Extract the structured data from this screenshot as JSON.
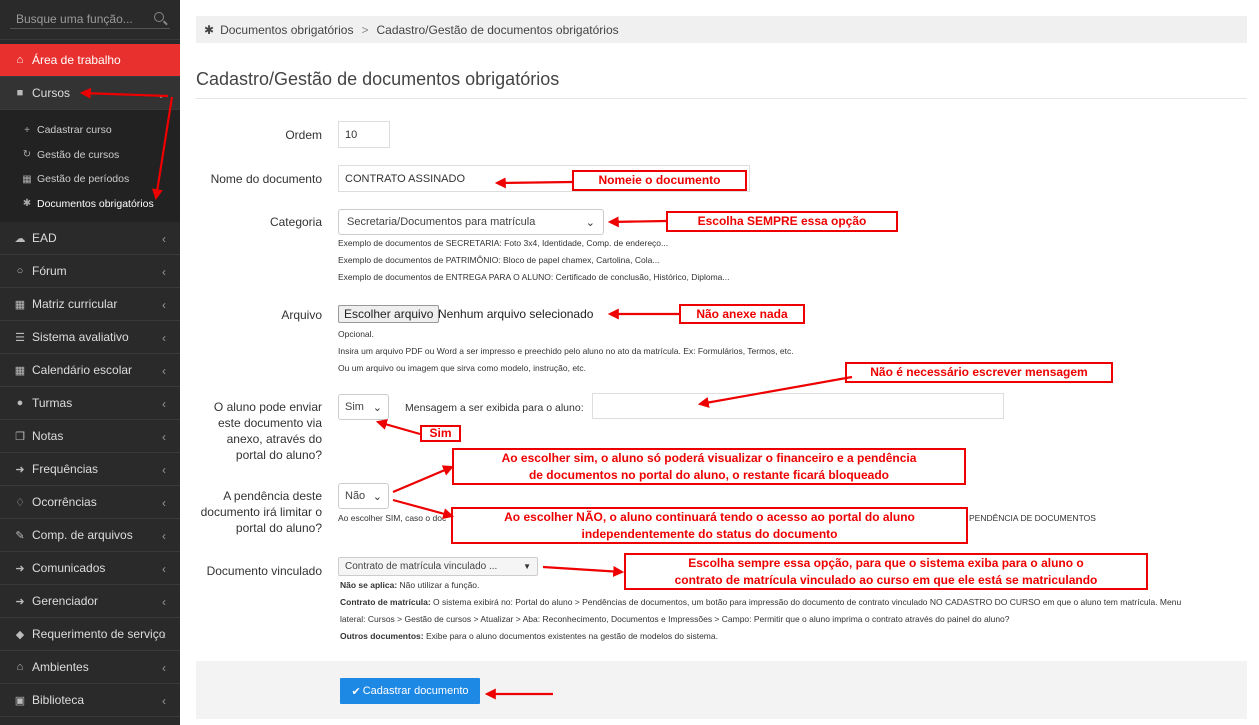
{
  "sidebar": {
    "search_placeholder": "Busque uma função...",
    "items": [
      {
        "label": "Área de trabalho",
        "icon": "home-icon"
      },
      {
        "label": "Cursos",
        "icon": "folder-icon"
      },
      {
        "label": "EAD",
        "icon": "cloud-icon"
      },
      {
        "label": "Fórum",
        "icon": "chat-icon"
      },
      {
        "label": "Matriz curricular",
        "icon": "grid-icon"
      },
      {
        "label": "Sistema avaliativo",
        "icon": "list-icon"
      },
      {
        "label": "Calendário escolar",
        "icon": "calendar-icon"
      },
      {
        "label": "Turmas",
        "icon": "users-icon"
      },
      {
        "label": "Notas",
        "icon": "copy-icon"
      },
      {
        "label": "Frequências",
        "icon": "sign-in-icon"
      },
      {
        "label": "Ocorrências",
        "icon": "bell-icon"
      },
      {
        "label": "Comp. de arquivos",
        "icon": "paperclip-icon"
      },
      {
        "label": "Comunicados",
        "icon": "sign-in-icon"
      },
      {
        "label": "Gerenciador",
        "icon": "sign-in-icon"
      },
      {
        "label": "Requerimento de serviço",
        "icon": "tag-icon"
      },
      {
        "label": "Ambientes",
        "icon": "home-icon"
      },
      {
        "label": "Biblioteca",
        "icon": "book-icon"
      }
    ],
    "subitems": [
      {
        "label": "Cadastrar curso",
        "icon": "plus-icon"
      },
      {
        "label": "Gestão de cursos",
        "icon": "refresh-icon"
      },
      {
        "label": "Gestão de períodos",
        "icon": "calendar-icon"
      },
      {
        "label": "Documentos obrigatórios",
        "icon": "asterisk-icon"
      }
    ]
  },
  "breadcrumb": {
    "item1": "Documentos obrigatórios",
    "separator": ">",
    "item2": "Cadastro/Gestão de documentos obrigatórios"
  },
  "page_title": "Cadastro/Gestão de documentos obrigatórios",
  "form": {
    "ordem_label": "Ordem",
    "ordem_value": "10",
    "nome_label": "Nome do documento",
    "nome_value": "CONTRATO ASSINADO",
    "categoria_label": "Categoria",
    "categoria_value": "Secretaria/Documentos para matrícula",
    "categoria_help": [
      "Exemplo de documentos de SECRETARIA: Foto 3x4, Identidade, Comp. de endereço...",
      "Exemplo de documentos de PATRIMÔNIO: Bloco de papel chamex, Cartolina, Cola...",
      "Exemplo de documentos de ENTREGA PARA O ALUNO: Certificado de conclusão, Histórico, Diploma..."
    ],
    "arquivo_label": "Arquivo",
    "arquivo_button": "Escolher arquivo",
    "arquivo_none": "Nenhum arquivo selecionado",
    "arquivo_help": [
      "Opcional.",
      "Insira um arquivo PDF ou Word a ser impresso e preechido pelo aluno no ato da matrícula. Ex: Formulários, Termos, etc.",
      "Ou um arquivo ou imagem que sirva como modelo, instrução, etc."
    ],
    "enviar_label": "O aluno pode enviar este documento via anexo, através do portal do aluno?",
    "enviar_value": "Sim",
    "mensagem_label": "Mensagem a ser exibida para o aluno:",
    "mensagem_value": "",
    "pendencia_label": "A pendência deste documento irá limitar o portal do aluno?",
    "pendencia_value": "Não",
    "pendencia_help_start": "Ao escolher SIM, caso o doc",
    "pendencia_help_end": "PENDÊNCIA DE DOCUMENTOS",
    "vinculado_label": "Documento vinculado",
    "vinculado_value": "Contrato de matrícula vinculado ...",
    "vinculado_help": {
      "line1_bold": "Não se aplica:",
      "line1": " Não utilizar a função.",
      "line2_bold": "Contrato de matrícula:",
      "line2": " O sistema exibirá no: Portal do aluno > Pendências de documentos, um botão para impressão do documento de contrato vinculado NO CADASTRO DO CURSO em que o aluno tem matrícula. Menu",
      "line3": "lateral: Cursos > Gestão de cursos > Atualizar > Aba: Reconhecimento, Documentos e Impressões > Campo: Permitir que o aluno imprima o contrato através do painel do aluno?",
      "line4_bold": "Outros documentos:",
      "line4": " Exibe para o aluno documentos existentes na gestão de modelos do sistema."
    },
    "submit_label": "Cadastrar documento"
  },
  "annotations": {
    "nomeie": "Nomeie o documento",
    "categoria": "Escolha SEMPRE essa opção",
    "arquivo": "Não anexe nada",
    "mensagem": "Não é necessário escrever mensagem",
    "sim": "Sim",
    "ao_sim_1": "Ao escolher sim, o aluno só poderá visualizar o financeiro e a pendência",
    "ao_sim_2": "de documentos no portal do aluno, o restante ficará bloqueado",
    "ao_nao_1": "Ao escolher NÃO, o aluno continuará tendo o acesso ao portal do aluno",
    "ao_nao_2": "independentemente do status do documento",
    "vinculado_1": "Escolha sempre essa opção, para que o sistema exiba para o aluno o",
    "vinculado_2": "contrato de matrícula vinculado ao curso em que ele está se matriculando"
  },
  "colors": {
    "active": "#e8312e",
    "annotation": "#e00000",
    "primary_button": "#1e88e5",
    "sidebar_bg": "#2a2a2a"
  }
}
